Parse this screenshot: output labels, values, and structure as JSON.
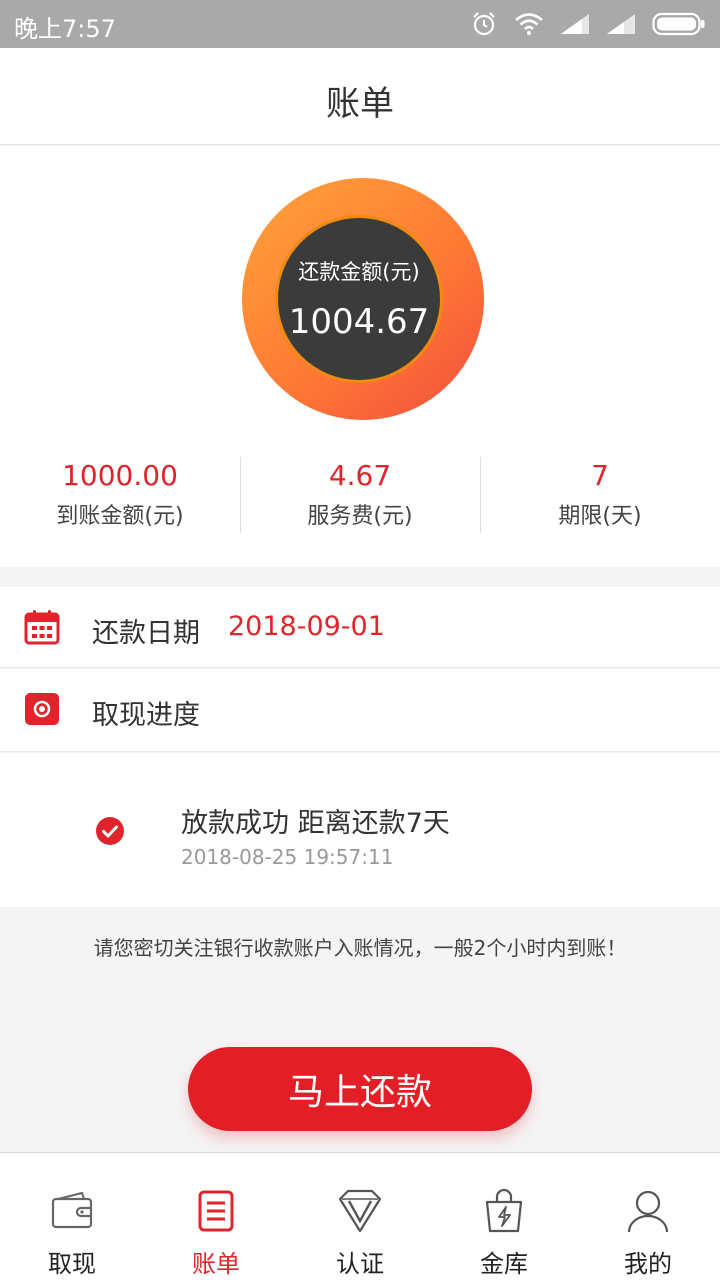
{
  "status_bar": {
    "time": "晚上7:57",
    "icons": [
      "alarm-icon",
      "wifi-icon",
      "signal-icon",
      "signal-icon",
      "battery-icon"
    ]
  },
  "header": {
    "title": "账单"
  },
  "repayment": {
    "label": "还款金额(元)",
    "amount": "1004.67"
  },
  "stats": [
    {
      "value": "1000.00",
      "label": "到账金额(元)"
    },
    {
      "value": "4.67",
      "label": "服务费(元)"
    },
    {
      "value": "7",
      "label": "期限(天)"
    }
  ],
  "due_date": {
    "label": "还款日期",
    "value": "2018-09-01",
    "icon": "calendar-icon"
  },
  "progress": {
    "label": "取现进度",
    "icon": "progress-record-icon"
  },
  "progress_event": {
    "title": "放款成功 距离还款7天",
    "time": "2018-08-25 19:57:11",
    "icon": "check-icon"
  },
  "notice": "请您密切关注银行收款账户入账情况，一般2个小时内到账！",
  "pay_button": {
    "label": "马上还款"
  },
  "tabbar": {
    "tabs": [
      {
        "label": "取现",
        "icon": "wallet-icon"
      },
      {
        "label": "账单",
        "icon": "bill-icon"
      },
      {
        "label": "认证",
        "icon": "verify-icon"
      },
      {
        "label": "金库",
        "icon": "shopping-bag-icon"
      },
      {
        "label": "我的",
        "icon": "user-icon"
      }
    ]
  },
  "colors": {
    "accent": "#e0242c",
    "button": "#e41e26",
    "ring_start": "#ffa43b",
    "ring_end": "#f24f3e",
    "ring_center": "#3b3b3b"
  }
}
